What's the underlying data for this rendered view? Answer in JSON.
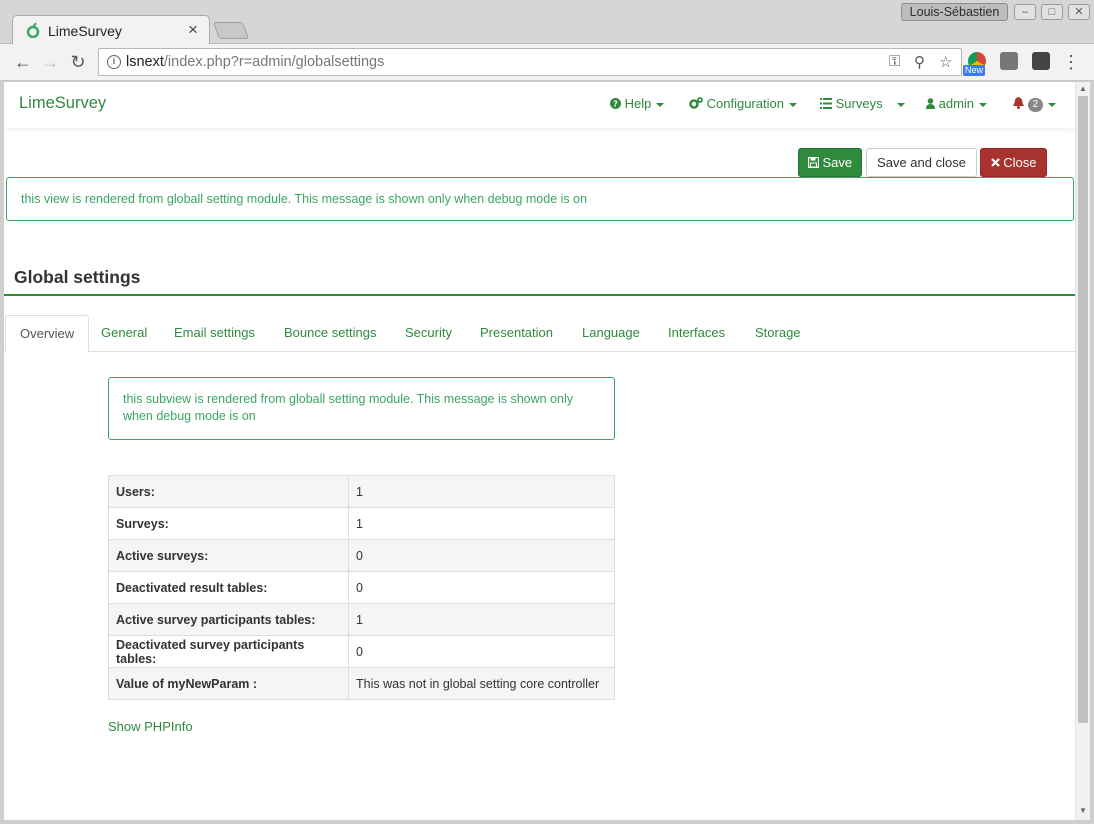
{
  "browser": {
    "tab_title": "LimeSurvey",
    "tab_close": "×",
    "profile_name": "Louis-Sébastien",
    "url_host": "lsnext",
    "url_path": "/index.php?r=admin/globalsettings",
    "new_label": "New",
    "back": "←",
    "forward": "→",
    "reload": "↻",
    "menu": "⋮",
    "key": "⚿",
    "zoom": "⚲",
    "star": "☆",
    "minimize": "–",
    "maximize": "□",
    "close": "✕"
  },
  "navbar": {
    "brand": "LimeSurvey",
    "help": "Help",
    "configuration": "Configuration",
    "surveys": "Surveys",
    "admin": "admin",
    "notifications_count": "2"
  },
  "actions": {
    "save": "Save",
    "save_and_close": "Save and close",
    "close": "Close"
  },
  "debug_message": "this view is rendered from globall setting module. This message is shown only when debug mode is on",
  "page_title": "Global settings",
  "tabs": [
    "Overview",
    "General",
    "Email settings",
    "Bounce settings",
    "Security",
    "Presentation",
    "Language",
    "Interfaces",
    "Storage"
  ],
  "subview_message": "this subview is rendered from globall setting module. This message is shown only when debug mode is on",
  "stats": [
    {
      "label": "Users:",
      "value": "1"
    },
    {
      "label": "Surveys:",
      "value": "1"
    },
    {
      "label": "Active surveys:",
      "value": "0"
    },
    {
      "label": "Deactivated result tables:",
      "value": "0"
    },
    {
      "label": "Active survey participants tables:",
      "value": "1"
    },
    {
      "label": "Deactivated survey participants tables:",
      "value": "0"
    },
    {
      "label": "Value of myNewParam :",
      "value": "This was not in global setting core controller"
    }
  ],
  "phpinfo_link": "Show PHPInfo",
  "colors": {
    "accent": "#2f8a3e",
    "alert_text": "#3aa565",
    "danger": "#a8322d"
  }
}
